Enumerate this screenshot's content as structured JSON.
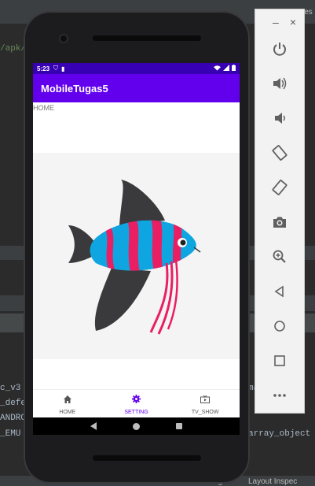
{
  "ide": {
    "path_fragment": "/apk/",
    "top_right_text": "Des",
    "code_lines": [
      "c_v3",
      "_defe",
      "ANDRO",
      "_EMU"
    ],
    "right_code": "array_object",
    "right_code_top": "ma",
    "bottom_items": [
      "Event Log",
      "Layout Inspec"
    ]
  },
  "status_bar": {
    "time": "5:23",
    "bg_color": "#3700b3"
  },
  "app_bar": {
    "title": "MobileTugas5",
    "bg_color": "#6200ee"
  },
  "fragment": {
    "label": "HOME"
  },
  "bottom_nav": {
    "items": [
      {
        "label": "HOME",
        "icon": "home-icon",
        "active": false
      },
      {
        "label": "SETTING",
        "icon": "gear-icon",
        "active": true
      },
      {
        "label": "TV_SHOW",
        "icon": "tv-icon",
        "active": false
      }
    ],
    "active_color": "#6200ee"
  },
  "emulator_toolbar": {
    "header_controls": [
      "minimize",
      "close"
    ],
    "buttons": [
      "power-icon",
      "volume-up-icon",
      "volume-down-icon",
      "rotate-left-icon",
      "rotate-right-icon",
      "camera-icon",
      "zoom-icon",
      "back-icon",
      "home-icon",
      "overview-icon",
      "more-icon"
    ]
  }
}
